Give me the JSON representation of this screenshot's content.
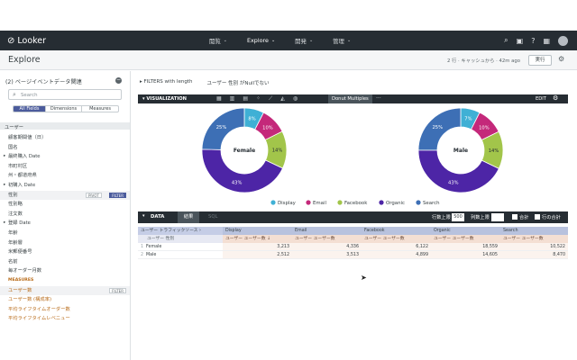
{
  "nav": {
    "logo": "Looker",
    "menu": [
      "閲覧",
      "Explore",
      "開発",
      "管理"
    ],
    "active_menu": "Explore"
  },
  "explore": {
    "title": "Explore",
    "meta": "2 行 · キャッシュから · 42m ago",
    "run_label": "実行"
  },
  "sidebar": {
    "title": "(2) ページイベントデータ関連",
    "search_placeholder": "Search",
    "tabs": [
      "All Fields",
      "Dimensions",
      "Measures"
    ],
    "active_tab": "All Fields",
    "view_name": "ユーザー",
    "fields": [
      {
        "label": "顧客期間値（日）",
        "kind": "dim"
      },
      {
        "label": "国名",
        "kind": "dim"
      },
      {
        "label": "最終購入 Date",
        "kind": "group"
      },
      {
        "label": "市町村区",
        "kind": "dim"
      },
      {
        "label": "州・都道府県",
        "kind": "dim"
      },
      {
        "label": "初購入 Date",
        "kind": "group"
      },
      {
        "label": "性別",
        "kind": "dim",
        "selected": true,
        "buttons": [
          "PIVOT",
          "FILTER"
        ]
      },
      {
        "label": "性別略",
        "kind": "dim"
      },
      {
        "label": "注文数",
        "kind": "dim"
      },
      {
        "label": "登録 Date",
        "kind": "group"
      },
      {
        "label": "年齢",
        "kind": "dim"
      },
      {
        "label": "年齢層",
        "kind": "dim"
      },
      {
        "label": "米郵便番号",
        "kind": "dim"
      },
      {
        "label": "名前",
        "kind": "dim"
      },
      {
        "label": "毎オーダー月数",
        "kind": "dim"
      },
      {
        "label": "MEASURES",
        "kind": "section"
      },
      {
        "label": "ユーザー数",
        "kind": "measure",
        "selected": true,
        "buttons": [
          "FILTER"
        ]
      },
      {
        "label": "ユーザー数 (構成率)",
        "kind": "measure"
      },
      {
        "label": "平均ライフタイムオーダー数",
        "kind": "measure"
      },
      {
        "label": "平均ライフタイムレベニュー",
        "kind": "measure"
      }
    ]
  },
  "filters": {
    "label": "FILTERS with length",
    "condition": "ユーザー 性別 がNullでない"
  },
  "visualization": {
    "label": "VISUALIZATION",
    "active_type": "Donut Multiples",
    "edit_label": "EDIT",
    "more": "···"
  },
  "colors": {
    "Display": "#3fb0d5",
    "Email": "#c4287a",
    "Facebook": "#a2c54a",
    "Organic": "#4d25a6",
    "Search": "#3d6fb5",
    "nav_bg": "#262d33"
  },
  "chart_data": {
    "type": "pie",
    "subtype": "donut-multiples",
    "categories": [
      "Display",
      "Email",
      "Facebook",
      "Organic",
      "Search"
    ],
    "legend_position": "bottom",
    "charts": [
      {
        "name": "Female",
        "values": [
          3213,
          4336,
          6122,
          18559,
          10522
        ],
        "labels": [
          "8%",
          "10%",
          "14%",
          "43%",
          "25%"
        ]
      },
      {
        "name": "Male",
        "values": [
          2512,
          3513,
          4899,
          14605,
          8470
        ],
        "labels": [
          "7%",
          "10%",
          "14%",
          "43%",
          "25%"
        ]
      }
    ]
  },
  "data": {
    "label": "DATA",
    "tabs": [
      "結果",
      "SQL"
    ],
    "row_limit_label": "行数上限",
    "row_limit": "500",
    "col_limit_label": "列数上限",
    "totals_label": "合計",
    "row_totals_label": "行の合計"
  },
  "table": {
    "pivot_header": "ユーザー トラフィックソース ›",
    "dim_header": "ユーザー 性別",
    "pivots": [
      "Display",
      "Email",
      "Facebook",
      "Organic",
      "Search"
    ],
    "measure_header": "ユーザー ユーザー数",
    "measure_header_sorted": "ユーザー ユーザー数 ↓",
    "rows": [
      {
        "n": "1",
        "label": "Female",
        "values": [
          "3,213",
          "4,336",
          "6,122",
          "18,559",
          "10,522"
        ]
      },
      {
        "n": "2",
        "label": "Male",
        "values": [
          "2,512",
          "3,513",
          "4,899",
          "14,605",
          "8,470"
        ]
      }
    ]
  }
}
